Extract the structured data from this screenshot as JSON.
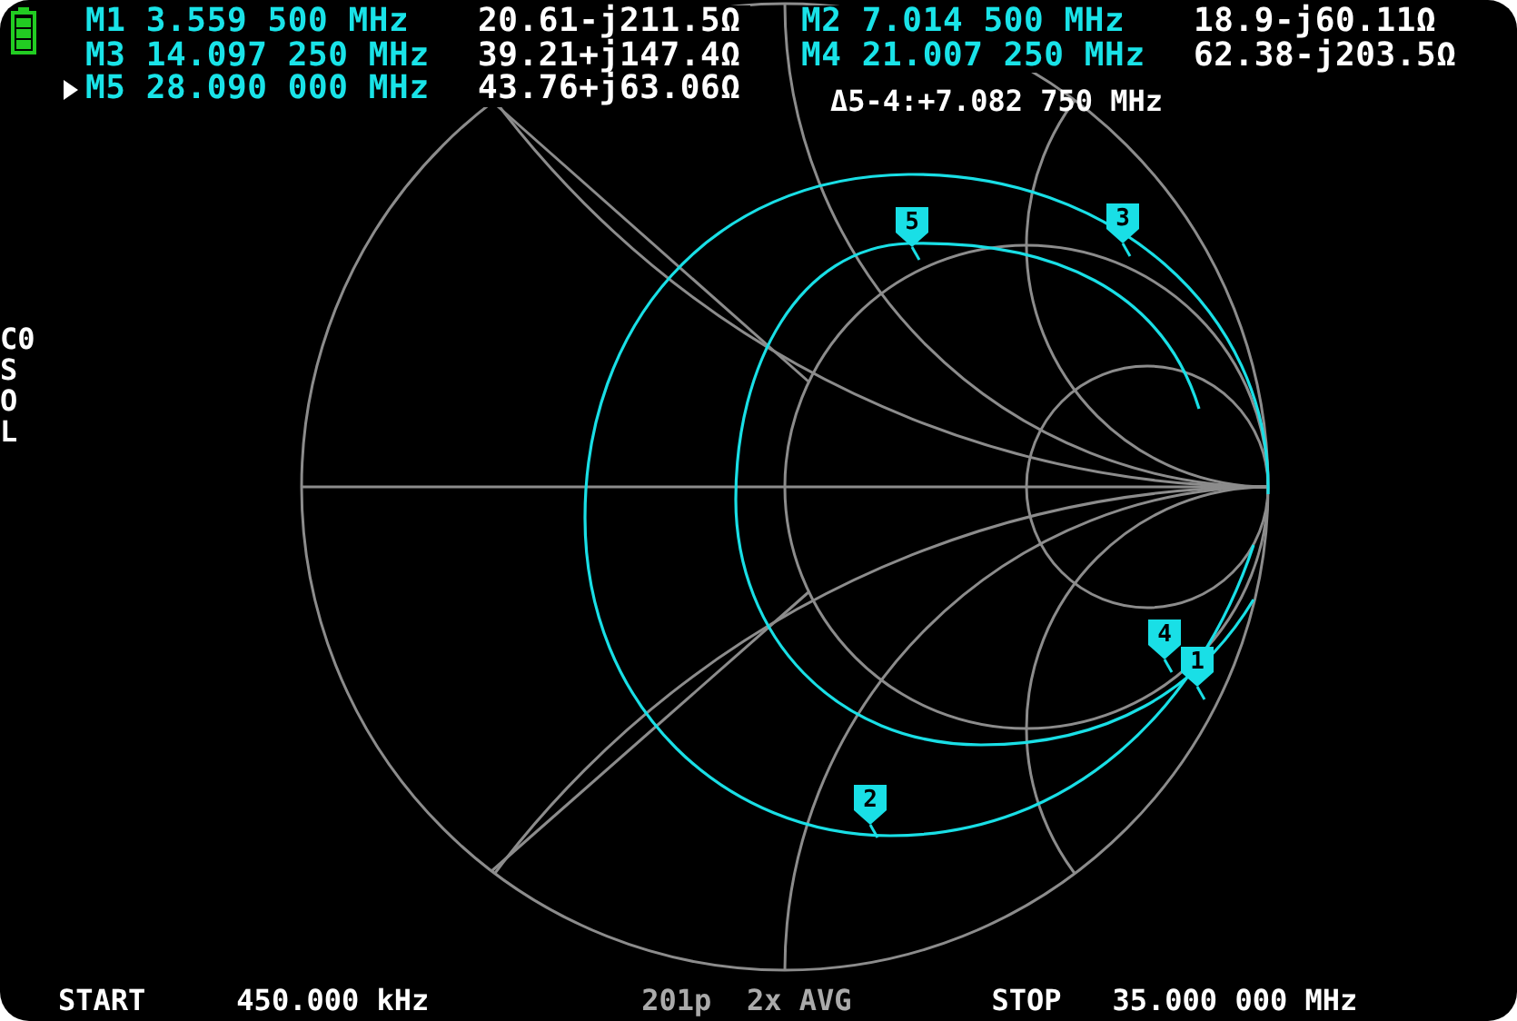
{
  "left_markers": [
    {
      "name": "M1",
      "frequency": "3.559 500 MHz",
      "impedance": "20.61-j211.5Ω",
      "selected": false
    },
    {
      "name": "M3",
      "frequency": "14.097 250 MHz",
      "impedance": "39.21+j147.4Ω",
      "selected": false
    },
    {
      "name": "M5",
      "frequency": "28.090 000 MHz",
      "impedance": "43.76+j63.06Ω",
      "selected": true
    }
  ],
  "right_markers": [
    {
      "name": "M2",
      "frequency": "7.014 500 MHz",
      "impedance": "18.9-j60.11Ω",
      "selected": false
    },
    {
      "name": "M4",
      "frequency": "21.007 250 MHz",
      "impedance": "62.38-j203.5Ω",
      "selected": false
    }
  ],
  "delta": "Δ5-4:+7.082 750 MHz",
  "calibration": [
    "C0",
    "S",
    "O",
    "L"
  ],
  "chart_markers": [
    "5",
    "3",
    "4",
    "1",
    "2"
  ],
  "footer": {
    "start_label": "START",
    "start_value": "450.000 kHz",
    "info": "201p  2x AVG",
    "stop_label": "STOP",
    "stop_value": "35.000 000 MHz"
  }
}
